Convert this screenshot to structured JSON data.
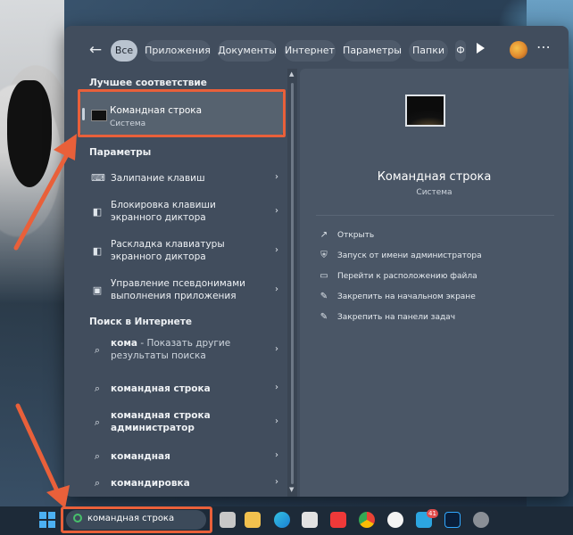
{
  "filters": {
    "chips": [
      "Все",
      "Приложения",
      "Документы",
      "Интернет",
      "Параметры",
      "Папки",
      "Ф"
    ]
  },
  "best_match": {
    "heading": "Лучшее соответствие",
    "title": "Командная строка",
    "subtitle": "Система"
  },
  "settings": {
    "heading": "Параметры",
    "items": [
      {
        "label": "Залипание клавиш"
      },
      {
        "label": "Блокировка клавиши экранного диктора"
      },
      {
        "label": "Раскладка клавиатуры экранного диктора"
      },
      {
        "label": "Управление псевдонимами выполнения приложения"
      }
    ]
  },
  "web": {
    "heading": "Поиск в Интернете",
    "items": [
      {
        "bold": "кома",
        "rest": " - Показать другие результаты поиска"
      },
      {
        "bold": "командная строка",
        "rest": ""
      },
      {
        "bold": "командная строка администратор",
        "rest": ""
      },
      {
        "bold": "командная",
        "rest": ""
      },
      {
        "bold": "командировка",
        "rest": ""
      }
    ]
  },
  "detail": {
    "app_name": "Командная строка",
    "app_type": "Система",
    "actions": [
      "Открыть",
      "Запуск от имени администратора",
      "Перейти к расположению файла",
      "Закрепить на начальном экране",
      "Закрепить на панели задач"
    ]
  },
  "taskbar": {
    "search_value": "командная строка",
    "badge": "41"
  },
  "colors": {
    "highlight": "#e9603a",
    "accent": "#4cb0f2"
  }
}
